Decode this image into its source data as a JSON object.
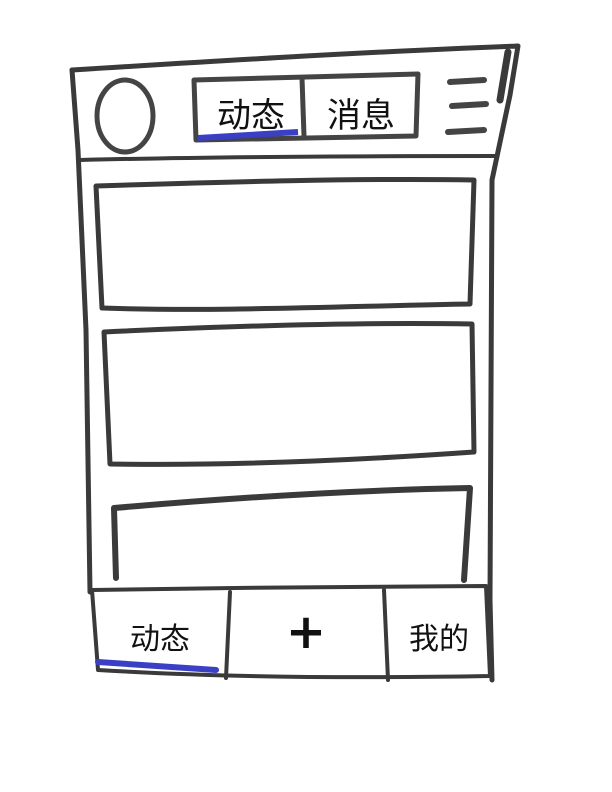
{
  "header": {
    "tabs": [
      {
        "label": "动态",
        "active": true
      },
      {
        "label": "消息",
        "active": false
      }
    ],
    "avatar_icon": "avatar-circle",
    "menu_icon": "hamburger-menu-icon"
  },
  "feed": {
    "cards": [
      {
        "content": ""
      },
      {
        "content": ""
      },
      {
        "content": ""
      }
    ]
  },
  "bottom_nav": {
    "items": [
      {
        "label": "动态",
        "active": true
      },
      {
        "label": "+",
        "active": false
      },
      {
        "label": "我的",
        "active": false
      }
    ]
  },
  "colors": {
    "stroke": "#333333",
    "active_underline": "#3a3fc4"
  }
}
